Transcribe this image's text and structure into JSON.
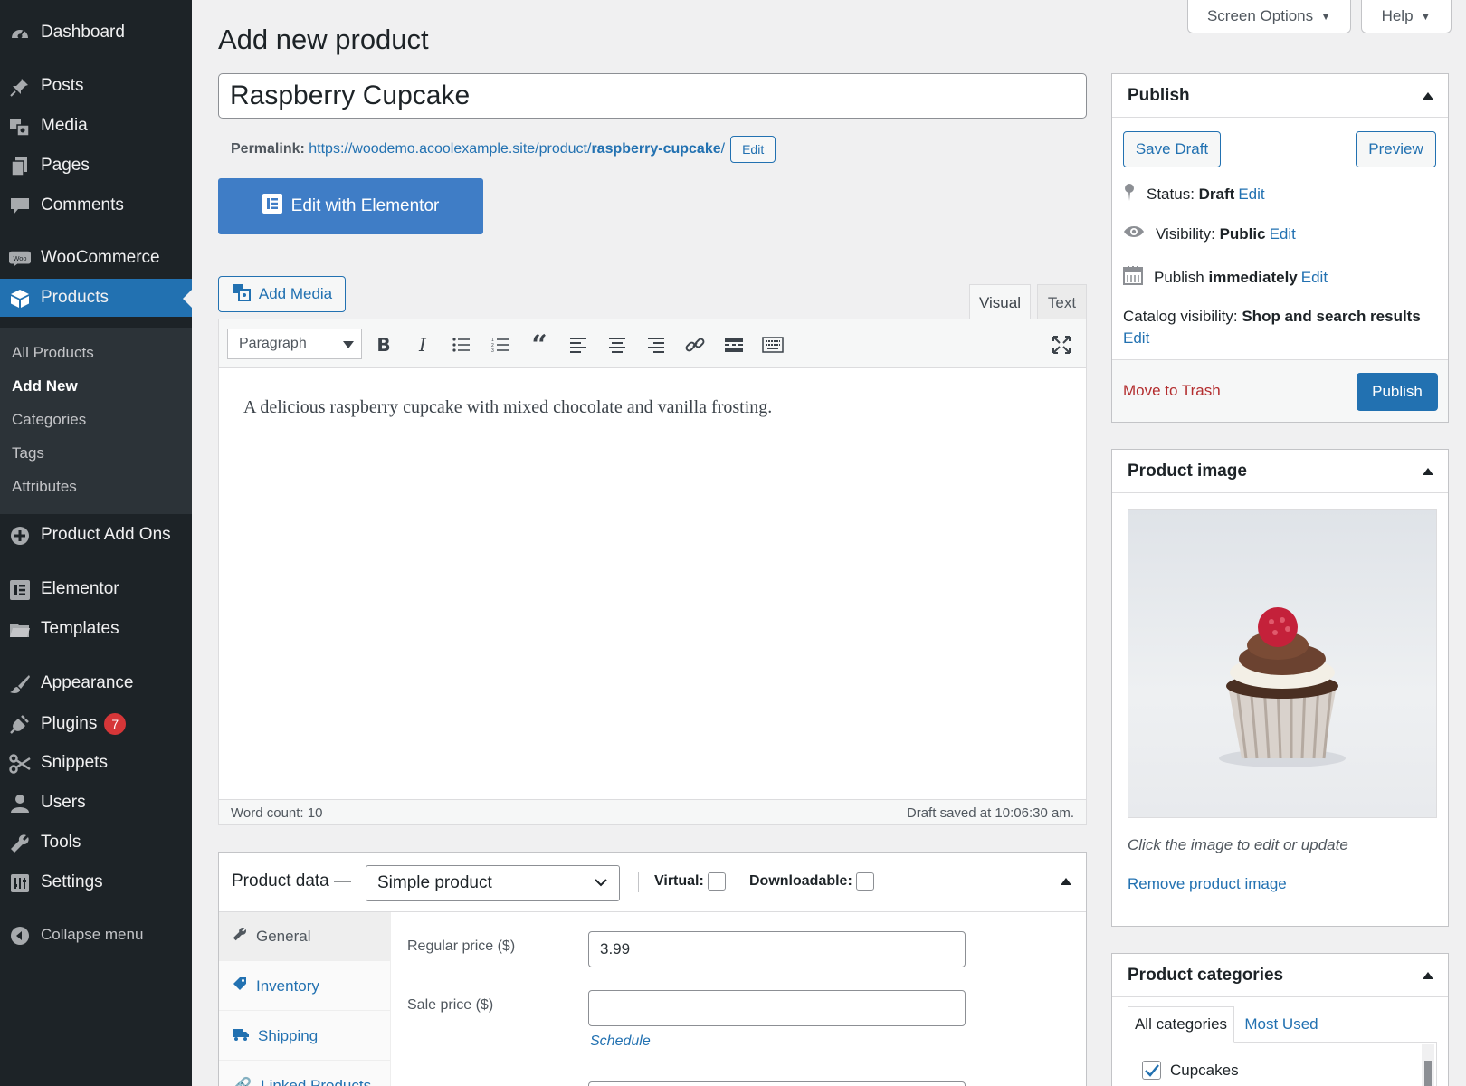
{
  "sidebar": {
    "items": [
      {
        "label": "Dashboard",
        "icon": "dashboard-icon"
      },
      {
        "label": "Posts",
        "icon": "pin-icon"
      },
      {
        "label": "Media",
        "icon": "media-icon"
      },
      {
        "label": "Pages",
        "icon": "pages-icon"
      },
      {
        "label": "Comments",
        "icon": "comment-icon"
      },
      {
        "label": "WooCommerce",
        "icon": "woo-icon"
      },
      {
        "label": "Products",
        "icon": "box-icon"
      },
      {
        "label": "Product Add Ons",
        "icon": "plus-circle-icon"
      },
      {
        "label": "Elementor",
        "icon": "elementor-icon"
      },
      {
        "label": "Templates",
        "icon": "folder-icon"
      },
      {
        "label": "Appearance",
        "icon": "brush-icon"
      },
      {
        "label": "Plugins",
        "icon": "plug-icon",
        "badge": "7"
      },
      {
        "label": "Snippets",
        "icon": "scissors-icon"
      },
      {
        "label": "Users",
        "icon": "user-icon"
      },
      {
        "label": "Tools",
        "icon": "wrench-icon"
      },
      {
        "label": "Settings",
        "icon": "settings-icon"
      },
      {
        "label": "Collapse menu",
        "icon": "collapse-icon"
      }
    ],
    "submenu": [
      "All Products",
      "Add New",
      "Categories",
      "Tags",
      "Attributes"
    ]
  },
  "topbar": {
    "screen_options": "Screen Options",
    "help": "Help"
  },
  "page": {
    "title": "Add new product"
  },
  "post": {
    "title": "Raspberry Cupcake",
    "permalink_label": "Permalink:",
    "permalink_base": "https://woodemo.acoolexample.site/product/",
    "permalink_slug": "raspberry-cupcake",
    "permalink_trail": "/",
    "permalink_edit": "Edit",
    "elementor_button": "Edit with Elementor"
  },
  "editor": {
    "add_media": "Add Media",
    "tab_visual": "Visual",
    "tab_text": "Text",
    "format": "Paragraph",
    "content": "A delicious raspberry cupcake with mixed chocolate and vanilla frosting.",
    "word_count": "Word count: 10",
    "draft_saved": "Draft saved at 10:06:30 am."
  },
  "product_data": {
    "label": "Product data —",
    "type": "Simple product",
    "virtual": "Virtual:",
    "downloadable": "Downloadable:",
    "tabs": [
      "General",
      "Inventory",
      "Shipping",
      "Linked Products"
    ],
    "regular_price_label": "Regular price ($)",
    "regular_price": "3.99",
    "sale_price_label": "Sale price ($)",
    "sale_price": "",
    "schedule": "Schedule"
  },
  "publish": {
    "title": "Publish",
    "save_draft": "Save Draft",
    "preview": "Preview",
    "status_label": "Status:",
    "status_value": "Draft",
    "visibility_label": "Visibility:",
    "visibility_value": "Public",
    "publish_label": "Publish",
    "publish_value": "immediately",
    "catalog_label": "Catalog visibility:",
    "catalog_value": "Shop and search results",
    "edit": "Edit",
    "trash": "Move to Trash",
    "publish_button": "Publish"
  },
  "product_image": {
    "title": "Product image",
    "hint": "Click the image to edit or update",
    "remove": "Remove product image"
  },
  "categories": {
    "title": "Product categories",
    "tab_all": "All categories",
    "tab_used": "Most Used",
    "items": [
      {
        "label": "Cupcakes",
        "checked": true
      }
    ]
  },
  "colors": {
    "sidebar": "#1d2327",
    "accent": "#2271b1",
    "elementor": "#3f7dc6",
    "badge": "#d63638"
  }
}
